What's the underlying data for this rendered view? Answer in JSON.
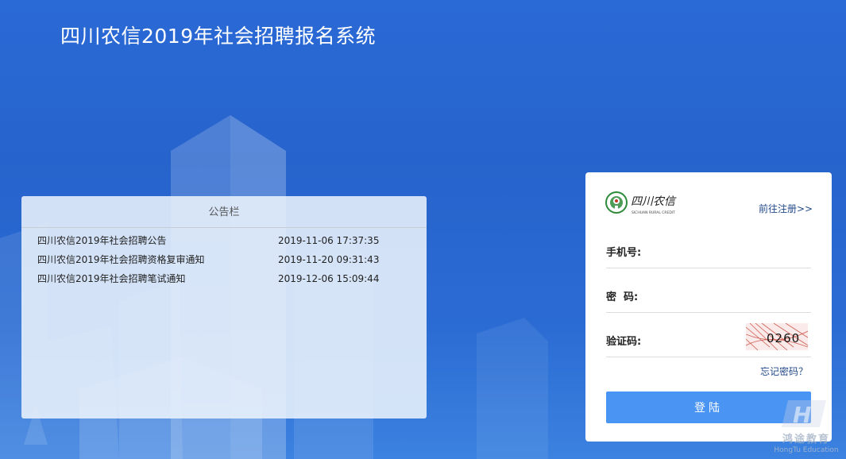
{
  "header": {
    "title": "四川农信2019年社会招聘报名系统"
  },
  "notice_board": {
    "title": "公告栏",
    "items": [
      {
        "title": "四川农信2019年社会招聘公告",
        "date": "2019-11-06 17:37:35"
      },
      {
        "title": "四川农信2019年社会招聘资格复审通知",
        "date": "2019-11-20 09:31:43"
      },
      {
        "title": "四川农信2019年社会招聘笔试通知",
        "date": "2019-12-06 15:09:44"
      }
    ]
  },
  "login": {
    "logo_text": "四川农信",
    "logo_subtext": "SICHUAN RURAL CREDIT",
    "register_link": "前往注册>>",
    "phone_label": "手机号:",
    "phone_value": "",
    "password_label": "密  码:",
    "password_value": "",
    "captcha_label": "验证码:",
    "captcha_value": "",
    "captcha_text": "0260",
    "forgot_link": "忘记密码？",
    "submit_label": "登陆"
  },
  "watermark": {
    "name": "鸿途教育",
    "subtitle": "HongTu Education"
  },
  "colors": {
    "background": "#2763cc",
    "button": "#4a94f4",
    "link": "#234a8a",
    "logo_green": "#2e8b3a",
    "logo_red": "#c0392b"
  }
}
